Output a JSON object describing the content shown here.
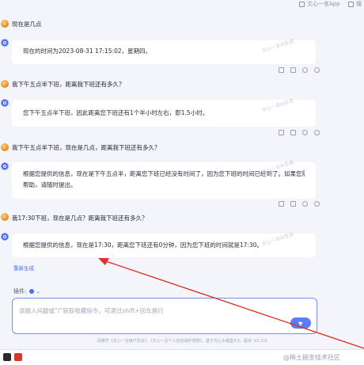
{
  "topbar": {
    "app_label": "文心一言App",
    "search_label": "搜"
  },
  "messages": [
    {
      "question": "现在是几点",
      "answer": "现在的时间为2023-08-31 17:15:02，星期四。"
    },
    {
      "question": "我下午五点半下班，距离我下班还有多久？",
      "answer": "您下午五点半下班，因此距离您下班还有1个半小时左右，即1.5小时。"
    },
    {
      "question": "我下午五点半下班，现在是几点，距离我下班还有多久？",
      "answer_line1": "根据您提供的信息，现在是下午五点半，距离您下班已经没有时间了，因为您下班的时间已经到了。如果您需要",
      "answer_line2": "帮助，请随时提出。"
    },
    {
      "question": "我17:30下班，现在是几点？距离我下班还有多久？",
      "answer": "根据您提供的信息，现在是17:30，距离您下班还有0分钟，因为您下班的时间就是17:30。"
    }
  ],
  "watermark": "文心一言AI生成",
  "regenerate_label": "重新生成",
  "plugin": {
    "label": "插件:",
    "value": "⌄"
  },
  "input": {
    "placeholder": "请输入问题或“/”获取收藏指令，可通过shift+回车换行"
  },
  "footer_text": "请遵守《文心一言用户协议》、《文心一言个人信息保护规则》，基于文心大模型3.5，版本: V2.3.0",
  "bottom_bar": {
    "brand": "@稀土掘金技术社区"
  },
  "colors": {
    "accent": "#4b6cf0",
    "annotation_arrow": "#e0322b"
  }
}
